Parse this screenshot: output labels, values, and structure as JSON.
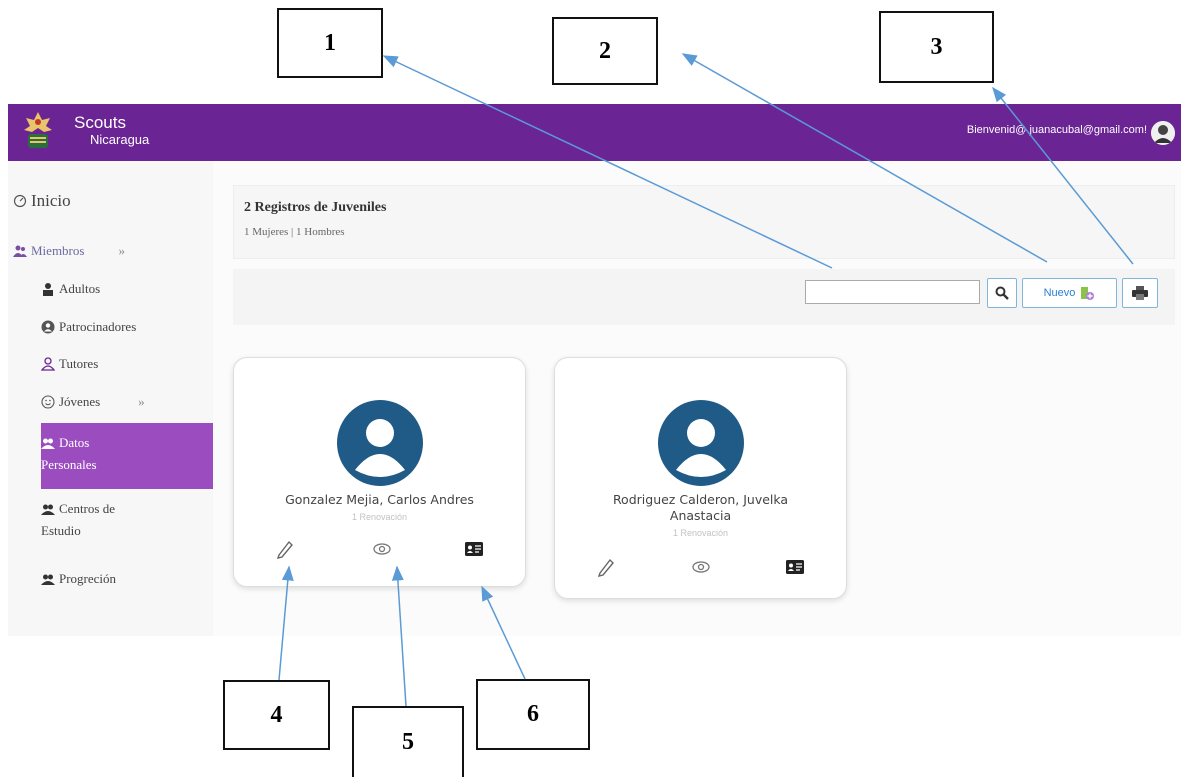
{
  "callouts": [
    "1",
    "2",
    "3",
    "4",
    "5",
    "6"
  ],
  "header": {
    "brand_line1": "Scouts",
    "brand_line2": "Nicaragua",
    "welcome": "Bienvenid@ juanacubal@gmail.com!"
  },
  "sidebar": {
    "items": [
      {
        "label": "Inicio"
      },
      {
        "label": "Miembros",
        "chevron": "»"
      },
      {
        "label": "Adultos"
      },
      {
        "label": "Patrocinadores"
      },
      {
        "label": "Tutores"
      },
      {
        "label": "Jóvenes",
        "chevron": "»"
      },
      {
        "label_line1": "Datos",
        "label_line2": "Personales"
      },
      {
        "label_line1": "Centros de",
        "label_line2": "Estudio"
      },
      {
        "label": "Progreción"
      }
    ]
  },
  "summary": {
    "title": "2 Registros de Juveniles",
    "subtitle": "1 Mujeres | 1 Hombres"
  },
  "toolbar": {
    "search_value": "",
    "new_label": "Nuevo"
  },
  "cards": [
    {
      "name": "Gonzalez Mejia, Carlos Andres",
      "status": "1 Renovación"
    },
    {
      "name_line1": "Rodriguez Calderon, Juvelka",
      "name_line2": "Anastacia",
      "status": "1 Renovación"
    }
  ],
  "colors": {
    "header_bg": "#6a2493",
    "active_nav_bg": "#9b4dc0",
    "avatar_blue": "#1f5b86",
    "arrow": "#5b9bd5"
  }
}
